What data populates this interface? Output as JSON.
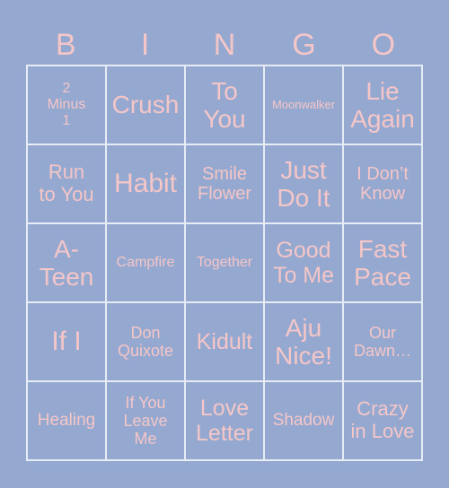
{
  "header": {
    "letters": [
      "B",
      "I",
      "N",
      "G",
      "O"
    ]
  },
  "colors": {
    "background": "#94a8d0",
    "text": "#f5c6c8",
    "grid_lines": "#e6ecf5"
  },
  "cells": [
    [
      "2\nMinus\n1",
      "Crush",
      "To\nYou",
      "Moonwalker",
      "Lie\nAgain"
    ],
    [
      "Run\nto You",
      "Habit",
      "Smile\nFlower",
      "Just\nDo It",
      "I Don’t\nKnow"
    ],
    [
      "A-\nTeen",
      "Campfire",
      "Together",
      "Good\nTo Me",
      "Fast\nPace"
    ],
    [
      "If I",
      "Don\nQuixote",
      "Kidult",
      "Aju\nNice!",
      "Our\nDawn…"
    ],
    [
      "Healing",
      "If You\nLeave\nMe",
      "Love\nLetter",
      "Shadow",
      "Crazy\nin Love"
    ]
  ]
}
